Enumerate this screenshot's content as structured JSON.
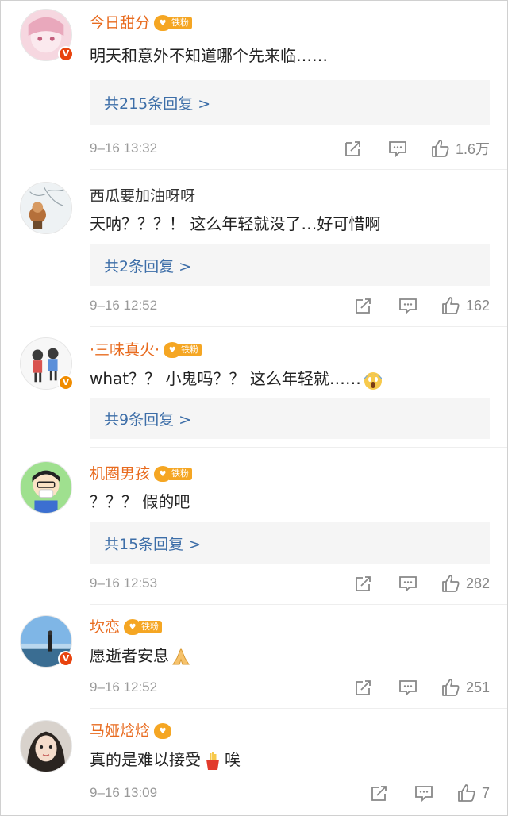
{
  "comments": [
    {
      "username": "今日甜分",
      "has_fan_badge": true,
      "fan_badge_label": "铁粉",
      "text": "明天和意外不知道哪个先来临……",
      "reply_link": "共215条回复 >",
      "time": "9–16 13:32",
      "likes": "1.6万"
    },
    {
      "username": "西瓜要加油呀呀",
      "has_fan_badge": false,
      "text": "天呐？？？！ 这么年轻就没了…好可惜啊",
      "reply_link": "共2条回复 >",
      "time": "9–16 12:52",
      "likes": "162"
    },
    {
      "username": "·三味真火·",
      "has_fan_badge": true,
      "fan_badge_label": "铁粉",
      "text": "what？？ 小鬼吗？？ 这么年轻就……",
      "reply_link": "共9条回复 >",
      "time": "",
      "likes": ""
    },
    {
      "username": "机圈男孩",
      "has_fan_badge": true,
      "fan_badge_label": "铁粉",
      "text": "？？？ 假的吧",
      "reply_link": "共15条回复 >",
      "time": "9–16 12:53",
      "likes": "282"
    },
    {
      "username": "坎恋",
      "has_fan_badge": true,
      "fan_badge_label": "铁粉",
      "text": "愿逝者安息",
      "reply_link": "",
      "time": "9–16 12:52",
      "likes": "251"
    },
    {
      "username": "马娅焓焓",
      "has_fan_badge": true,
      "fan_badge_label": "",
      "text": "真的是难以接受",
      "text_suffix": "唉",
      "reply_link": "",
      "time": "9–16 13:09",
      "likes": "7"
    }
  ],
  "icons": {
    "share": "share-icon",
    "comment": "comment-icon",
    "like": "thumbs-up-icon",
    "verified": "verified-v-icon"
  },
  "colors": {
    "username": "#e86b1f",
    "reply_link": "#3d6ea8",
    "reply_bg": "#f5f5f5",
    "meta_text": "#999999",
    "fan_badge": "#f5a623"
  }
}
